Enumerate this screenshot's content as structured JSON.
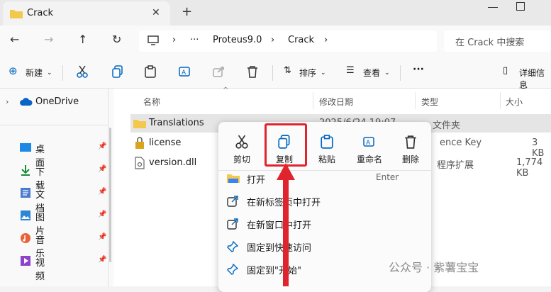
{
  "tab": {
    "title": "Crack",
    "close": "✕"
  },
  "window": {
    "new_tab": "+"
  },
  "nav": {
    "back": "←",
    "forward": "→",
    "up": "↑",
    "refresh": "↻",
    "more": "···",
    "sep1": "›",
    "sep2": "›",
    "sep3": "›"
  },
  "breadcrumb": {
    "parent": "Proteus9.0",
    "current": "Crack"
  },
  "search": {
    "placeholder": "在 Crack 中搜索"
  },
  "toolbar": {
    "new_label": "新建",
    "sort_label": "排序",
    "view_label": "查看",
    "more_label": "···",
    "details_label": "详细信息"
  },
  "sidebar": {
    "onedrive": "OneDrive",
    "items": [
      {
        "label": "桌面",
        "icon": "desktop-icon"
      },
      {
        "label": "下载",
        "icon": "download-icon"
      },
      {
        "label": "文档",
        "icon": "documents-icon"
      },
      {
        "label": "图片",
        "icon": "pictures-icon"
      },
      {
        "label": "音乐",
        "icon": "music-icon"
      },
      {
        "label": "视频",
        "icon": "videos-icon"
      }
    ]
  },
  "columns": {
    "name": "名称",
    "modified": "修改日期",
    "type": "类型",
    "size": "大小"
  },
  "files": [
    {
      "name": "Translations",
      "modified": "2025/6/24 19:07",
      "type": "文件夹",
      "size": ""
    },
    {
      "name": "license",
      "modified": "",
      "type": "ence Key",
      "size": "3 KB"
    },
    {
      "name": "version.dll",
      "modified": "",
      "type": "程序扩展",
      "size": "1,774 KB"
    }
  ],
  "context_menu": {
    "actions": [
      {
        "label": "剪切",
        "icon": "scissors-icon"
      },
      {
        "label": "复制",
        "icon": "copy-icon"
      },
      {
        "label": "粘贴",
        "icon": "paste-icon"
      },
      {
        "label": "重命名",
        "icon": "rename-icon"
      },
      {
        "label": "删除",
        "icon": "trash-icon"
      }
    ],
    "items": [
      {
        "label": "打开",
        "shortcut": "Enter"
      },
      {
        "label": "在新标签页中打开"
      },
      {
        "label": "在新窗口中打开"
      },
      {
        "label": "固定到快速访问"
      },
      {
        "label": "固定到\"开始\""
      }
    ]
  },
  "watermark": "公众号 · 紫薯宝宝",
  "colors": {
    "accent": "#0067c0",
    "highlight": "#e0242e",
    "folder": "#f2c94c"
  }
}
